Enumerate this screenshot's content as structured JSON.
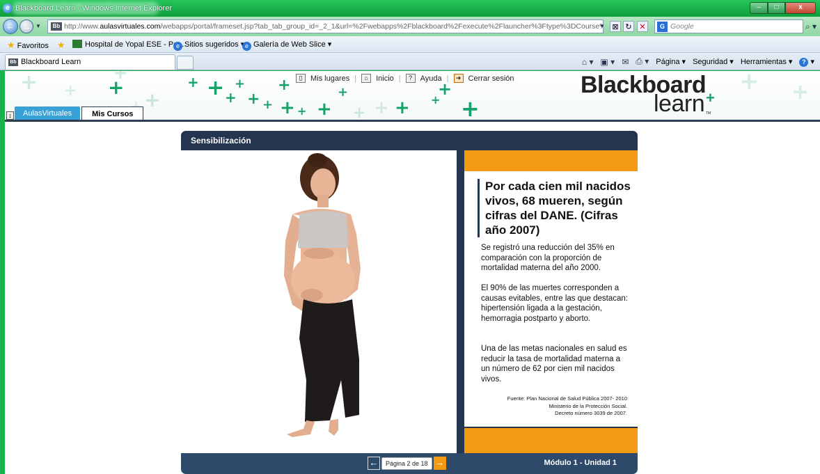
{
  "window": {
    "title": "Blackboard Learn - Windows Internet Explorer",
    "controls": {
      "minimize": "–",
      "maximize": "□",
      "close": "x"
    }
  },
  "addressbar": {
    "url_prefix": "http://www.",
    "url_host": "aulasvirtuales.com",
    "url_rest": "/webapps/portal/frameset.jsp?tab_tab_group_id=_2_1&url=%2Fwebapps%2Fblackboard%2Fexecute%2Flauncher%3Ftype%3DCourse%26id%3D_1(",
    "search_placeholder": "Google"
  },
  "favorites": {
    "favorites_label": "Favoritos",
    "items": [
      "Hospital de Yopal ESE - Pe...",
      "Sitios sugeridos ▾",
      "Galería de Web Slice ▾"
    ]
  },
  "tabs": {
    "active_tab": "Blackboard Learn",
    "commands": [
      "Página ▾",
      "Seguridad ▾",
      "Herramientas ▾"
    ]
  },
  "bb_header": {
    "links": [
      "Mis lugares",
      "Inicio",
      "Ayuda",
      "Cerrar sesión"
    ],
    "logo_line1": "Blackboard",
    "logo_line2": "learn",
    "logo_tm": "TM",
    "course_tabs": [
      "AulasVirtuales",
      "Mis Cursos"
    ]
  },
  "module": {
    "title": "Sensibilización",
    "headline": "Por cada cien mil nacidos vivos, 68 mueren, según cifras del DANE. (Cifras año 2007)",
    "paragraphs": [
      "Se registró una reducción del 35% en comparación con la proporción de mortalidad materna del año 2000.",
      "El 90% de las muertes corresponden a causas evitables, entre las que destacan: hipertensión ligada a la gestación, hemorragia postparto y aborto.",
      "Una de las metas nacionales en salud es reducir la tasa de mortalidad materna a un número de 62 por cien mil nacidos vivos."
    ],
    "source_lines": [
      "Fuente: Plan Nacional de Salud Pública 2007- 2010",
      "Ministerio de la Protección Social.",
      "Decreto número 3039  de 2007."
    ],
    "pager_label": "Página 2 de 18",
    "module_name": "Módulo 1 - Unidad 1"
  },
  "colors": {
    "navy": "#23354f",
    "orange": "#f39a13",
    "teal_plus": "#16a36a",
    "window_frame": "#19b24a"
  }
}
